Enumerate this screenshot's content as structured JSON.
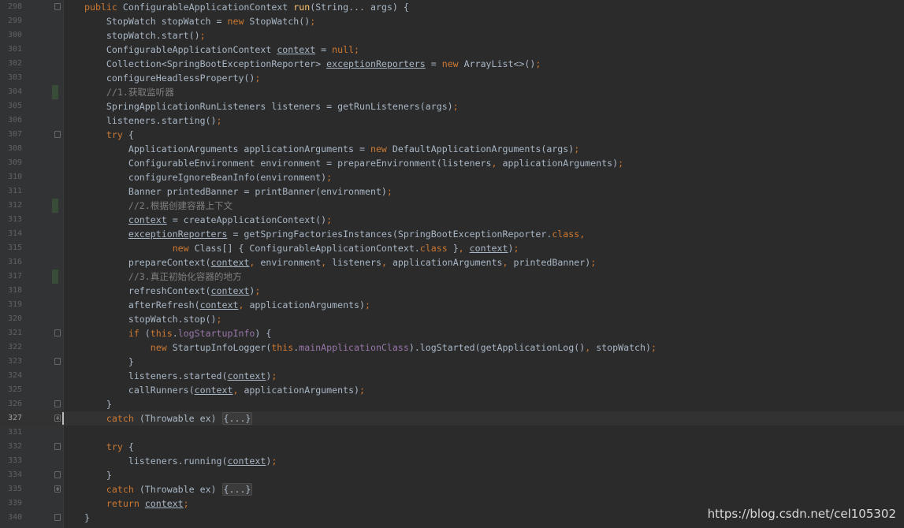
{
  "editor": {
    "current_line": "327",
    "lines": [
      {
        "num": "298",
        "fold": "minus",
        "change": false,
        "seg": [
          {
            "t": "public ",
            "c": "kw"
          },
          {
            "t": "ConfigurableApplicationContext "
          },
          {
            "t": "run",
            "c": "fn"
          },
          {
            "t": "(String... args) {"
          }
        ]
      },
      {
        "num": "299",
        "seg": [
          {
            "t": "    StopWatch stopWatch = "
          },
          {
            "t": "new ",
            "c": "kw"
          },
          {
            "t": "StopWatch()"
          },
          {
            "t": ";",
            "c": "kw"
          }
        ]
      },
      {
        "num": "300",
        "seg": [
          {
            "t": "    stopWatch.start()"
          },
          {
            "t": ";",
            "c": "kw"
          }
        ]
      },
      {
        "num": "301",
        "seg": [
          {
            "t": "    ConfigurableApplicationContext "
          },
          {
            "t": "context",
            "c": "ul"
          },
          {
            "t": " = "
          },
          {
            "t": "null;",
            "c": "kw"
          }
        ]
      },
      {
        "num": "302",
        "seg": [
          {
            "t": "    Collection<SpringBootExceptionReporter> "
          },
          {
            "t": "exceptionReporters",
            "c": "ul"
          },
          {
            "t": " = "
          },
          {
            "t": "new ",
            "c": "kw"
          },
          {
            "t": "ArrayList<>()"
          },
          {
            "t": ";",
            "c": "kw"
          }
        ]
      },
      {
        "num": "303",
        "seg": [
          {
            "t": "    configureHeadlessProperty()"
          },
          {
            "t": ";",
            "c": "kw"
          }
        ]
      },
      {
        "num": "304",
        "change": true,
        "seg": [
          {
            "t": "    //1.获取监听器",
            "c": "cm"
          }
        ]
      },
      {
        "num": "305",
        "seg": [
          {
            "t": "    SpringApplicationRunListeners listeners = getRunListeners(args)"
          },
          {
            "t": ";",
            "c": "kw"
          }
        ]
      },
      {
        "num": "306",
        "seg": [
          {
            "t": "    listeners.starting()"
          },
          {
            "t": ";",
            "c": "kw"
          }
        ]
      },
      {
        "num": "307",
        "fold": "minus",
        "seg": [
          {
            "t": "    "
          },
          {
            "t": "try ",
            "c": "kw"
          },
          {
            "t": "{"
          }
        ]
      },
      {
        "num": "308",
        "seg": [
          {
            "t": "        ApplicationArguments applicationArguments = "
          },
          {
            "t": "new ",
            "c": "kw"
          },
          {
            "t": "DefaultApplicationArguments(args)"
          },
          {
            "t": ";",
            "c": "kw"
          }
        ]
      },
      {
        "num": "309",
        "seg": [
          {
            "t": "        ConfigurableEnvironment environment = prepareEnvironment(listeners"
          },
          {
            "t": ", ",
            "c": "kw"
          },
          {
            "t": "applicationArguments)"
          },
          {
            "t": ";",
            "c": "kw"
          }
        ]
      },
      {
        "num": "310",
        "seg": [
          {
            "t": "        configureIgnoreBeanInfo(environment)"
          },
          {
            "t": ";",
            "c": "kw"
          }
        ]
      },
      {
        "num": "311",
        "seg": [
          {
            "t": "        Banner printedBanner = printBanner(environment)"
          },
          {
            "t": ";",
            "c": "kw"
          }
        ]
      },
      {
        "num": "312",
        "change": true,
        "seg": [
          {
            "t": "        //2.根据创建容器上下文",
            "c": "cm"
          }
        ]
      },
      {
        "num": "313",
        "seg": [
          {
            "t": "        "
          },
          {
            "t": "context",
            "c": "ul"
          },
          {
            "t": " = createApplicationContext()"
          },
          {
            "t": ";",
            "c": "kw"
          }
        ]
      },
      {
        "num": "314",
        "seg": [
          {
            "t": "        "
          },
          {
            "t": "exceptionReporters",
            "c": "ul"
          },
          {
            "t": " = getSpringFactoriesInstances(SpringBootExceptionReporter."
          },
          {
            "t": "class,",
            "c": "kw"
          }
        ]
      },
      {
        "num": "315",
        "seg": [
          {
            "t": "                "
          },
          {
            "t": "new ",
            "c": "kw"
          },
          {
            "t": "Class[] { ConfigurableApplicationContext."
          },
          {
            "t": "class ",
            "c": "kw"
          },
          {
            "t": "}"
          },
          {
            "t": ", ",
            "c": "kw"
          },
          {
            "t": "context",
            "c": "ul"
          },
          {
            "t": ")"
          },
          {
            "t": ";",
            "c": "kw"
          }
        ]
      },
      {
        "num": "316",
        "seg": [
          {
            "t": "        prepareContext("
          },
          {
            "t": "context",
            "c": "ul"
          },
          {
            "t": ", ",
            "c": "kw"
          },
          {
            "t": "environment"
          },
          {
            "t": ", ",
            "c": "kw"
          },
          {
            "t": "listeners"
          },
          {
            "t": ", ",
            "c": "kw"
          },
          {
            "t": "applicationArguments"
          },
          {
            "t": ", ",
            "c": "kw"
          },
          {
            "t": "printedBanner)"
          },
          {
            "t": ";",
            "c": "kw"
          }
        ]
      },
      {
        "num": "317",
        "change": true,
        "seg": [
          {
            "t": "        //3.真正初始化容器的地方",
            "c": "cm"
          }
        ]
      },
      {
        "num": "318",
        "seg": [
          {
            "t": "        refreshContext("
          },
          {
            "t": "context",
            "c": "ul"
          },
          {
            "t": ")"
          },
          {
            "t": ";",
            "c": "kw"
          }
        ]
      },
      {
        "num": "319",
        "seg": [
          {
            "t": "        afterRefresh("
          },
          {
            "t": "context",
            "c": "ul"
          },
          {
            "t": ", ",
            "c": "kw"
          },
          {
            "t": "applicationArguments)"
          },
          {
            "t": ";",
            "c": "kw"
          }
        ]
      },
      {
        "num": "320",
        "seg": [
          {
            "t": "        stopWatch.stop()"
          },
          {
            "t": ";",
            "c": "kw"
          }
        ]
      },
      {
        "num": "321",
        "fold": "minus",
        "seg": [
          {
            "t": "        "
          },
          {
            "t": "if ",
            "c": "kw"
          },
          {
            "t": "("
          },
          {
            "t": "this",
            "c": "kw"
          },
          {
            "t": "."
          },
          {
            "t": "logStartupInfo",
            "c": "fld"
          },
          {
            "t": ") {"
          }
        ]
      },
      {
        "num": "322",
        "seg": [
          {
            "t": "            "
          },
          {
            "t": "new ",
            "c": "kw"
          },
          {
            "t": "StartupInfoLogger("
          },
          {
            "t": "this",
            "c": "kw"
          },
          {
            "t": "."
          },
          {
            "t": "mainApplicationClass",
            "c": "fld"
          },
          {
            "t": ").logStarted(getApplicationLog()"
          },
          {
            "t": ", ",
            "c": "kw"
          },
          {
            "t": "stopWatch)"
          },
          {
            "t": ";",
            "c": "kw"
          }
        ]
      },
      {
        "num": "323",
        "fold": "minus",
        "seg": [
          {
            "t": "        }"
          }
        ]
      },
      {
        "num": "324",
        "seg": [
          {
            "t": "        listeners.started("
          },
          {
            "t": "context",
            "c": "ul"
          },
          {
            "t": ")"
          },
          {
            "t": ";",
            "c": "kw"
          }
        ]
      },
      {
        "num": "325",
        "seg": [
          {
            "t": "        callRunners("
          },
          {
            "t": "context",
            "c": "ul"
          },
          {
            "t": ", ",
            "c": "kw"
          },
          {
            "t": "applicationArguments)"
          },
          {
            "t": ";",
            "c": "kw"
          }
        ]
      },
      {
        "num": "326",
        "fold": "minus",
        "seg": [
          {
            "t": "    }"
          }
        ]
      },
      {
        "num": "327",
        "fold": "plus",
        "current": true,
        "seg": [
          {
            "t": "    "
          },
          {
            "t": "catch ",
            "c": "kw"
          },
          {
            "t": "(Throwable ex) "
          },
          {
            "t": "{...}",
            "c": "folded"
          }
        ]
      },
      {
        "num": "331",
        "seg": []
      },
      {
        "num": "332",
        "fold": "minus",
        "seg": [
          {
            "t": "    "
          },
          {
            "t": "try ",
            "c": "kw"
          },
          {
            "t": "{"
          }
        ]
      },
      {
        "num": "333",
        "seg": [
          {
            "t": "        listeners.running("
          },
          {
            "t": "context",
            "c": "ul"
          },
          {
            "t": ")"
          },
          {
            "t": ";",
            "c": "kw"
          }
        ]
      },
      {
        "num": "334",
        "fold": "minus",
        "seg": [
          {
            "t": "    }"
          }
        ]
      },
      {
        "num": "335",
        "fold": "plus",
        "seg": [
          {
            "t": "    "
          },
          {
            "t": "catch ",
            "c": "kw"
          },
          {
            "t": "(Throwable ex) "
          },
          {
            "t": "{...}",
            "c": "folded"
          }
        ]
      },
      {
        "num": "339",
        "seg": [
          {
            "t": "    "
          },
          {
            "t": "return ",
            "c": "kw"
          },
          {
            "t": "context",
            "c": "ul"
          },
          {
            "t": ";",
            "c": "kw"
          }
        ]
      },
      {
        "num": "340",
        "fold": "minus",
        "seg": [
          {
            "t": "}"
          }
        ]
      }
    ]
  },
  "watermark": "https://blog.csdn.net/cel105302",
  "colors": {
    "background": "#2b2b2b",
    "gutter": "#313335",
    "keyword": "#cc7832",
    "method_decl": "#ffc66d",
    "field": "#9876aa",
    "comment": "#808080",
    "default_text": "#a9b7c6",
    "line_number": "#606366"
  }
}
